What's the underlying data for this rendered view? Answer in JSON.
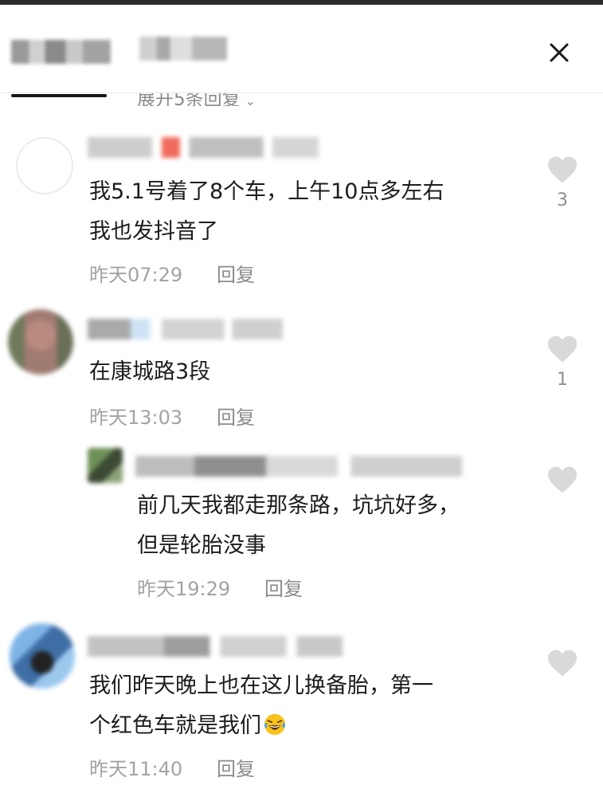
{
  "header": {
    "close_icon": "close-icon"
  },
  "expand_replies": {
    "label": "展开5条回复",
    "icon": "chevron-down-icon"
  },
  "comments": [
    {
      "text_lines": [
        "我5.1号着了8个车，上午10点多左右",
        "我也发抖音了"
      ],
      "time": "昨天07:29",
      "reply_label": "回复",
      "likes": "3"
    },
    {
      "text_lines": [
        "在康城路3段"
      ],
      "time": "昨天13:03",
      "reply_label": "回复",
      "likes": "1"
    },
    {
      "text_lines": [
        "前几天我都走那条路，坑坑好多，",
        "但是轮胎没事"
      ],
      "time": "昨天19:29",
      "reply_label": "回复",
      "likes": ""
    },
    {
      "text_lines": [
        "我们昨天晚上也在这儿换备胎，第一",
        "个红色车就是我们"
      ],
      "emoji": "laughing-crying-emoji",
      "time": "昨天11:40",
      "reply_label": "回复",
      "likes": ""
    }
  ],
  "colors": {
    "text": "#1c1c1c",
    "meta": "#a3a3a3",
    "heart": "#d9d9d9"
  }
}
